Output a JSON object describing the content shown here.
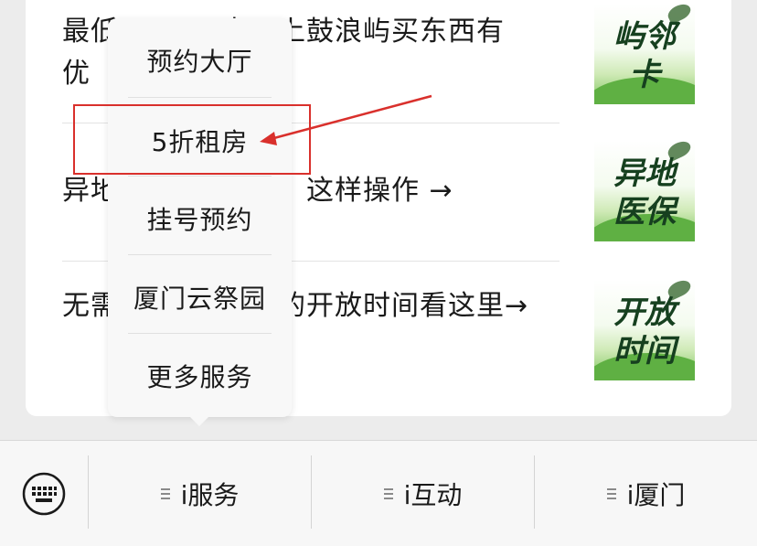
{
  "articles": [
    {
      "title": "最低       卡，上鼓浪屿买东西有优    ",
      "thumb_text": [
        "屿邻",
        "卡"
      ]
    },
    {
      "title": "异地       厦门，这样操作 →",
      "thumb_text": [
        "异地",
        "医保"
      ]
    },
    {
      "title": "无需       最全的开放时间看这里→",
      "thumb_text": [
        "开放",
        "时间"
      ]
    }
  ],
  "popup_menu": {
    "items": [
      "预约大厅",
      "5折租房",
      "挂号预约",
      "厦门云祭园",
      "更多服务"
    ],
    "highlighted_index": 1
  },
  "bottom_bar": {
    "keyboard_icon": "keyboard-icon",
    "tabs": [
      "i服务",
      "i互动",
      "i厦门"
    ],
    "tab_icon": "menu-lines-icon"
  },
  "colors": {
    "highlight": "#d9302c",
    "thumb_green": "#5fb043"
  }
}
